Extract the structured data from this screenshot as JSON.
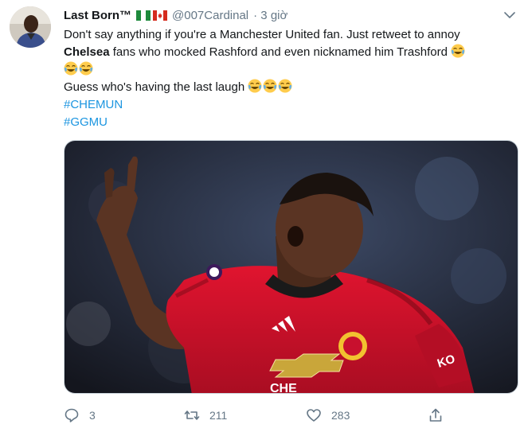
{
  "tweet": {
    "author_name": "Last Born™",
    "handle": "@007Cardinal",
    "time": "· 3 giờ",
    "flags": [
      "nigeria-flag",
      "canada-flag"
    ],
    "text_line1_a": "Don't say anything if you're a Manchester United fan. Just retweet to annoy",
    "text_line2_bold": "Chelsea",
    "text_line2_rest": " fans who mocked Rashford and even nicknamed him Trashford",
    "text_line4": "Guess who's having the last laugh",
    "emoji": "face-with-tears-of-joy",
    "hashtags": [
      "#CHEMUN",
      "#GGMU"
    ],
    "media": {
      "shirt_sponsor": "CHE",
      "sleeve_sponsor": "KO",
      "shirt_color": "#d3122c"
    }
  },
  "actions": {
    "replies": "3",
    "retweets": "211",
    "likes": "283"
  },
  "colors": {
    "link": "#1b95e0",
    "secondary": "#657786"
  }
}
